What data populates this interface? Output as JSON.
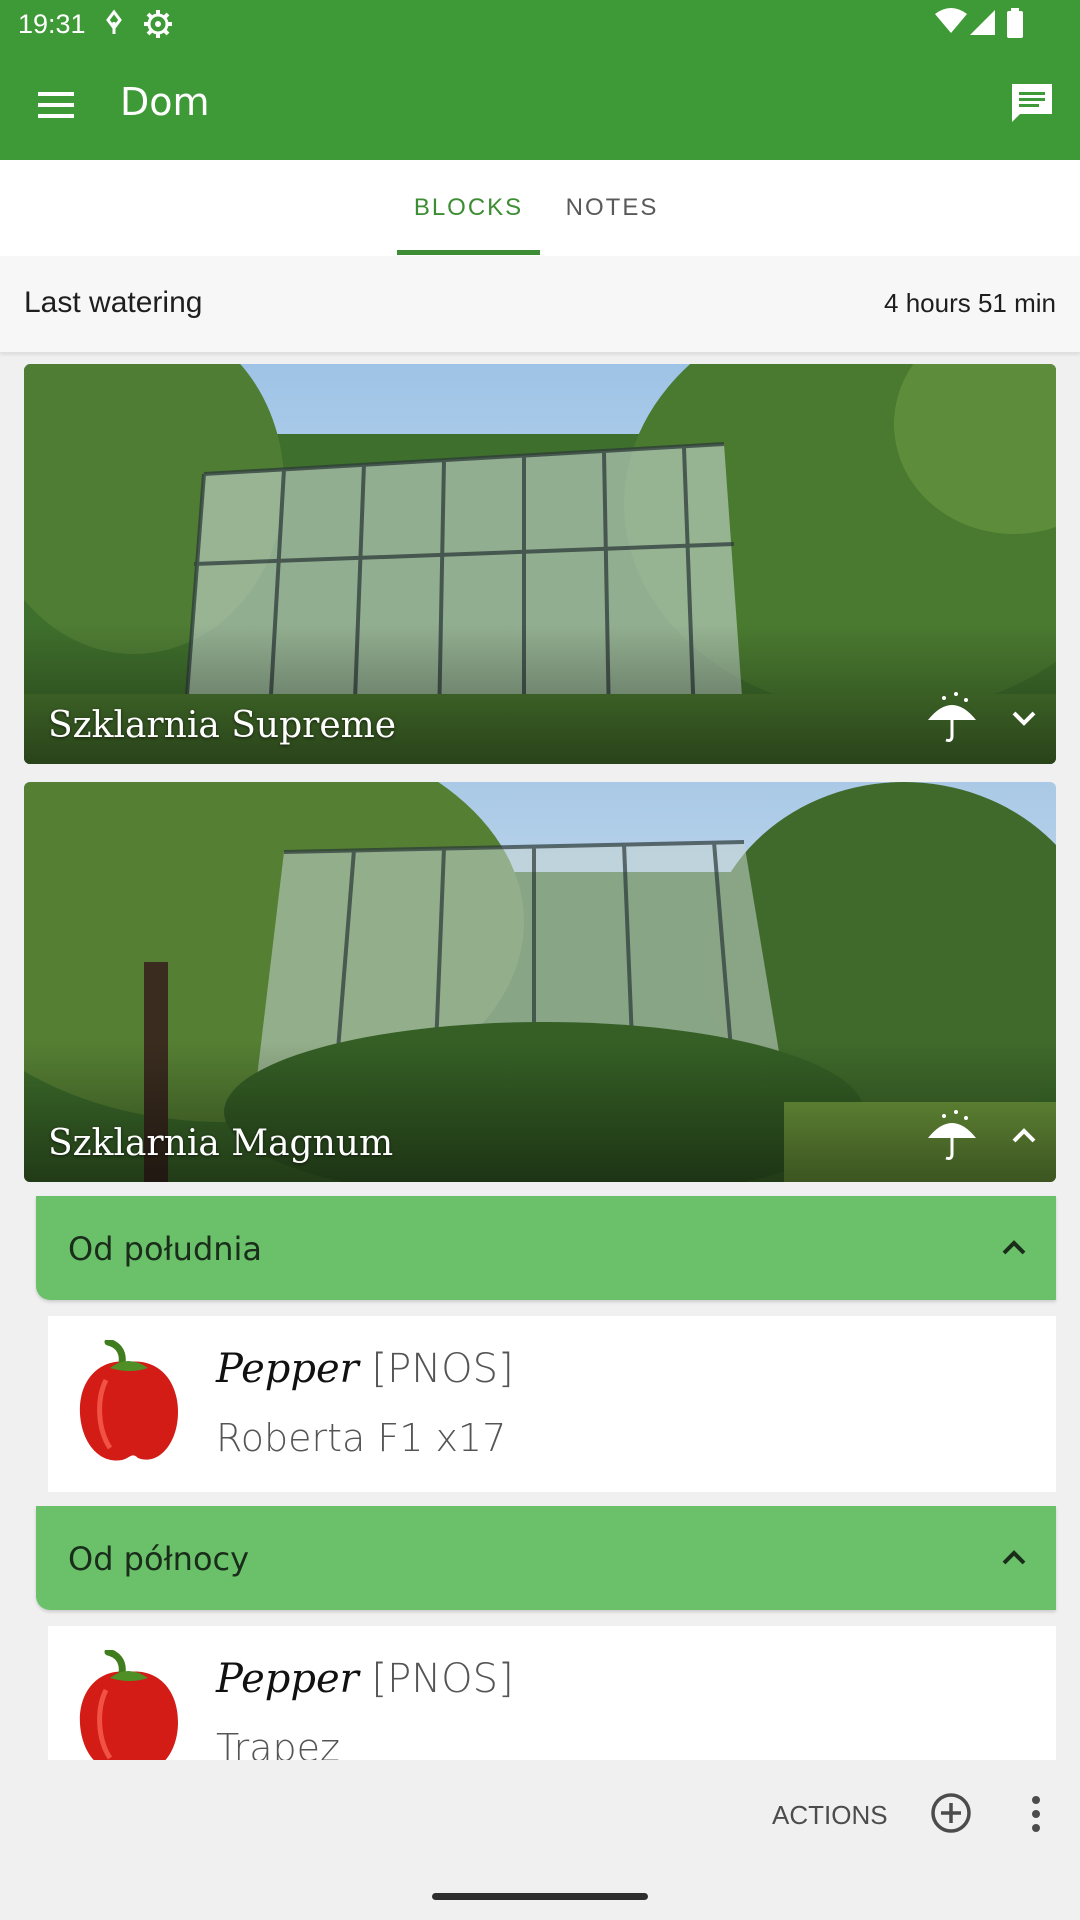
{
  "status_bar": {
    "time": "19:31"
  },
  "app_bar": {
    "title": "Dom"
  },
  "tabs": [
    {
      "label": "BLOCKS",
      "selected": true
    },
    {
      "label": "NOTES",
      "selected": false
    }
  ],
  "watering": {
    "label": "Last watering",
    "value": "4 hours 51 min"
  },
  "blocks": [
    {
      "name": "Szklarnia Supreme",
      "expanded": false
    },
    {
      "name": "Szklarnia Magnum",
      "expanded": true
    }
  ],
  "sections": [
    {
      "title": "Od południa",
      "plant": {
        "name": "Pepper",
        "code": "[PNOS]",
        "variety": "Roberta F1 x17"
      }
    },
    {
      "title": "Od północy",
      "plant": {
        "name": "Pepper",
        "code": "[PNOS]",
        "variety": "Trapez"
      }
    }
  ],
  "bottom_bar": {
    "actions_label": "ACTIONS"
  },
  "colors": {
    "primary": "#3d9a36",
    "section": "#6ac16a",
    "tab_accent": "#3d8d34"
  }
}
